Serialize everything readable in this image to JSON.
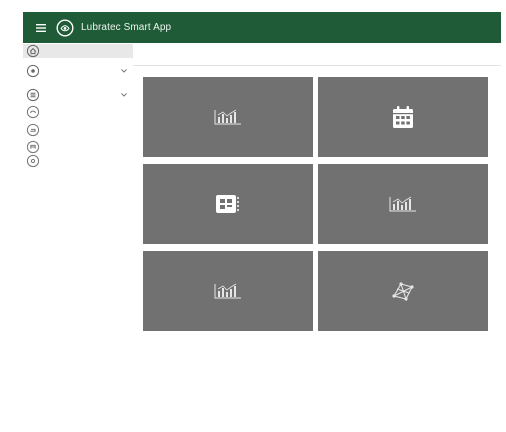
{
  "header": {
    "title": "Lubratec Smart App",
    "menu_icon": "hamburger-menu-icon",
    "logo_icon": "lubratec-logo-icon",
    "background_color": "#1e5b36"
  },
  "sidebar": {
    "items": [
      {
        "icon": "home-icon",
        "active": true,
        "expandable": false
      },
      {
        "icon": "settings-circle-icon",
        "active": false,
        "expandable": true
      },
      {
        "icon": "list-circle-icon",
        "active": false,
        "expandable": true
      },
      {
        "icon": "gauge-circle-icon",
        "active": false,
        "expandable": false
      },
      {
        "icon": "oil-circle-icon",
        "active": false,
        "expandable": false
      },
      {
        "icon": "pump-circle-icon",
        "active": false,
        "expandable": false
      },
      {
        "icon": "info-circle-icon",
        "active": false,
        "expandable": false
      }
    ]
  },
  "dashboard": {
    "tile_color": "#717171",
    "tiles": [
      {
        "icon": "bar-chart-icon"
      },
      {
        "icon": "calendar-icon"
      },
      {
        "icon": "controller-device-icon"
      },
      {
        "icon": "bar-chart-icon"
      },
      {
        "icon": "bar-chart-icon"
      },
      {
        "icon": "network-map-icon"
      }
    ]
  }
}
